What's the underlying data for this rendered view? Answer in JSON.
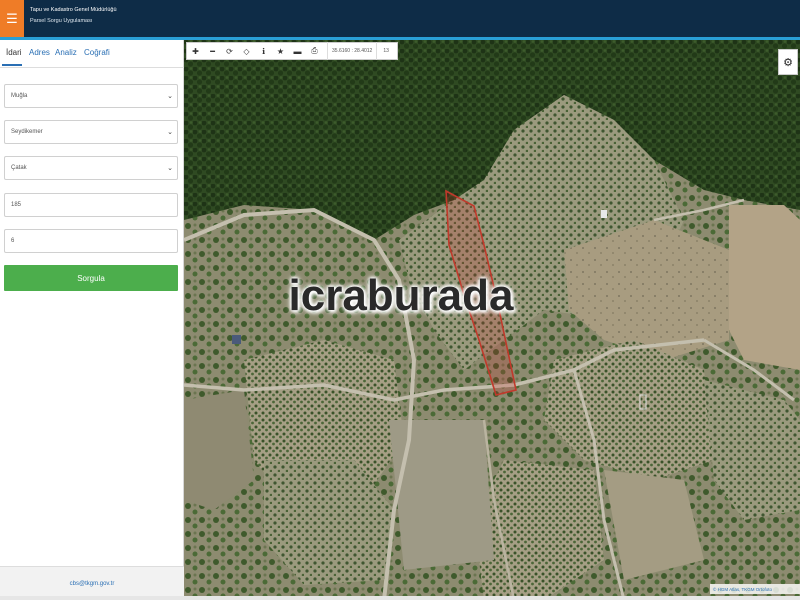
{
  "header": {
    "menu_icon": "☰",
    "org_title": "Tapu ve Kadastro Genel Müdürlüğü",
    "app_title": "Parsel Sorgu Uygulaması"
  },
  "sidebar": {
    "tabs": [
      {
        "label": "İdari",
        "active": true
      },
      {
        "label": "Adres"
      },
      {
        "label": "Analiz"
      },
      {
        "label": "Coğrafi"
      }
    ],
    "fields": {
      "province": "Muğla",
      "district": "Seydikemer",
      "neighborhood": "Çatak",
      "block": "185",
      "parcel": "6"
    },
    "query_button": "Sorgula",
    "footer_email": "cbs@tkgm.gov.tr"
  },
  "map": {
    "coordinates": "35.6160 : 28.4012",
    "zoom_level": "13",
    "watermark": "icraburada",
    "attribution": "© HGM Atlas, TKGM Ortofoto",
    "parcel_outline_color": "#c0392b"
  },
  "toolbar_icons": [
    "zoom-in-icon",
    "zoom-out-icon",
    "refresh-icon",
    "locate-icon",
    "info-icon",
    "home-icon",
    "measure-icon",
    "print-icon"
  ]
}
